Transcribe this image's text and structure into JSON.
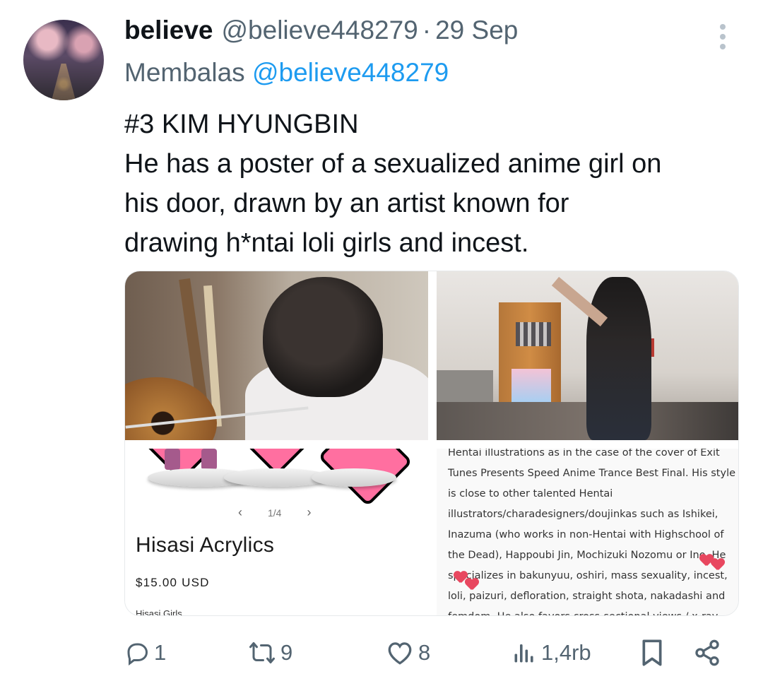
{
  "tweet": {
    "display_name": "believe",
    "handle": "@believe448279",
    "separator": "·",
    "date": "29 Sep",
    "reply_prefix": "Membalas",
    "reply_to": "@believe448279",
    "text_lines": [
      "#3 KIM HYUNGBIN",
      "He has a poster of a sexualized anime girl on",
      "his door, drawn by an artist known for",
      "drawing h*ntai loli girls and incest."
    ]
  },
  "media": {
    "shop_card": {
      "pager_prev": "‹",
      "pager_index": "1/4",
      "pager_next": "›",
      "product_title": "Hisasi Acrylics",
      "price": "$15.00 USD",
      "subtitle": "Hisasi Girls"
    },
    "article_lines": [
      "Hentai illustrations as in the case of the cover of Exit",
      "Tunes Presents Speed Anime Trance Best Final. His style",
      "is close to other talented Hentai",
      "illustrators/charadesigners/doujinkas such as Ishikei,",
      "Inazuma (who works in non-Hentai with Highschool of",
      "the Dead), Happoubi Jin, Mochizuki Nozomu or Ino. He",
      "specializes in bakunyuu, oshiri, mass sexuality, incest,",
      "loli, paizuri, defloration, straight shota, nakadashi and",
      "femdom. He also favors cross-sectional views / x-ray"
    ]
  },
  "actions": {
    "reply_count": "1",
    "retweet_count": "9",
    "like_count": "8",
    "views_count": "1,4rb"
  },
  "icons": [
    "more-icon",
    "reply-icon",
    "retweet-icon",
    "like-icon",
    "views-icon",
    "bookmark-icon",
    "share-icon"
  ],
  "colors": {
    "text": "#0f1419",
    "secondary": "#536471",
    "link": "#1d9bf0"
  }
}
